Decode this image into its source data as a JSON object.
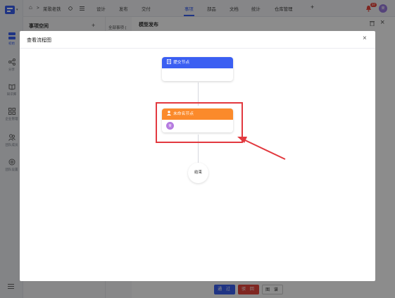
{
  "rail": {
    "items": [
      {
        "label": "初始",
        "icon": "grid-icon"
      },
      {
        "label": "分享",
        "icon": "share-icon"
      },
      {
        "label": "知识库",
        "icon": "book-icon"
      },
      {
        "label": "企业管理",
        "icon": "apps-icon"
      },
      {
        "label": "团队成员",
        "icon": "team-icon"
      },
      {
        "label": "团队设置",
        "icon": "settings-icon"
      }
    ]
  },
  "topbar": {
    "breadcrumb_home": "⌂",
    "breadcrumb_sep": ">",
    "workspace": "莱歌老铁",
    "tabs": [
      "设计",
      "发布",
      "交付",
      "事项",
      "部品",
      "文档",
      "统计",
      "仓库管理"
    ],
    "active_tab": "事项",
    "add": "+",
    "notification_count": "37",
    "avatar_text": "莱"
  },
  "background": {
    "left_title": "事项空间",
    "left_add": "+",
    "mid_label": "全部事项 (",
    "right_title": "模型发布",
    "approve": "通 过",
    "reject": "驳 回",
    "view_chart": "图 谱"
  },
  "dialog": {
    "title": "查看流程图",
    "close": "×",
    "submit_node": "提交节点",
    "unnamed_node": "未命名节点",
    "assignee_avatar": "莱",
    "end": "结束"
  },
  "colors": {
    "submit_node": "#3b5ff2",
    "unnamed_node": "#fb8a2b",
    "annotation": "#e2393f",
    "accent": "#3a5ff0"
  }
}
